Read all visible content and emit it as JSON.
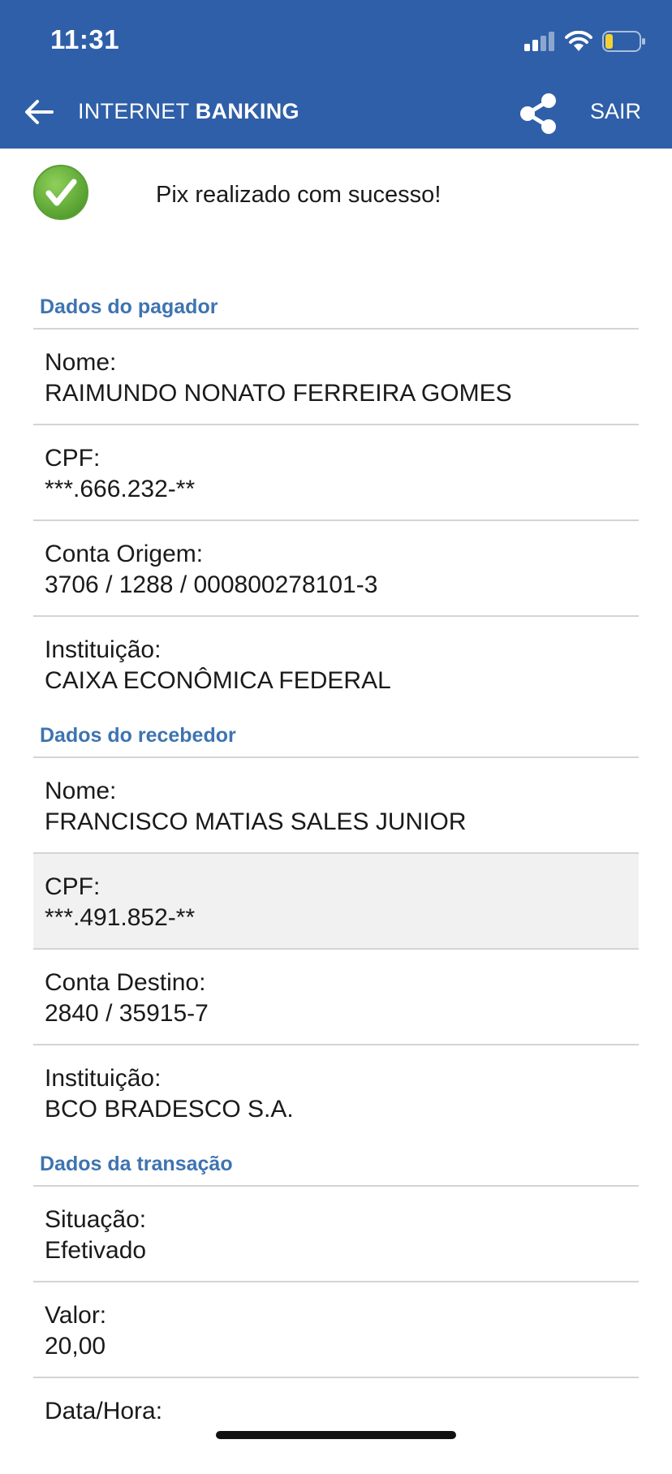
{
  "status_bar": {
    "time": "11:31"
  },
  "nav": {
    "title_light": "INTERNET",
    "title_bold": "BANKING",
    "logout_label": "SAIR"
  },
  "success": {
    "message": "Pix realizado com sucesso!"
  },
  "payer": {
    "title": "Dados do pagador",
    "name_label": "Nome:",
    "name_value": "RAIMUNDO NONATO FERREIRA GOMES",
    "cpf_label": "CPF:",
    "cpf_value": "***.666.232-**",
    "account_label": "Conta Origem:",
    "account_value": "3706 / 1288 / 000800278101-3",
    "institution_label": "Instituição:",
    "institution_value": "CAIXA ECONÔMICA FEDERAL"
  },
  "receiver": {
    "title": "Dados do recebedor",
    "name_label": "Nome:",
    "name_value": "FRANCISCO MATIAS SALES JUNIOR",
    "cpf_label": "CPF:",
    "cpf_value": "***.491.852-**",
    "account_label": "Conta Destino:",
    "account_value": "2840 / 35915-7",
    "institution_label": "Instituição:",
    "institution_value": "BCO BRADESCO S.A."
  },
  "transaction": {
    "title": "Dados da transação",
    "status_label": "Situação:",
    "status_value": "Efetivado",
    "amount_label": "Valor:",
    "amount_value": "20,00",
    "datetime_label": "Data/Hora:"
  },
  "colors": {
    "header_bg": "#2f5fa8",
    "section_title": "#3e74b0",
    "success_green": "#6cb33e",
    "highlight_row": "#f2f1f2"
  },
  "icons": [
    "signal-icon",
    "wifi-icon",
    "battery-icon",
    "back-arrow-icon",
    "share-icon",
    "check-icon"
  ]
}
